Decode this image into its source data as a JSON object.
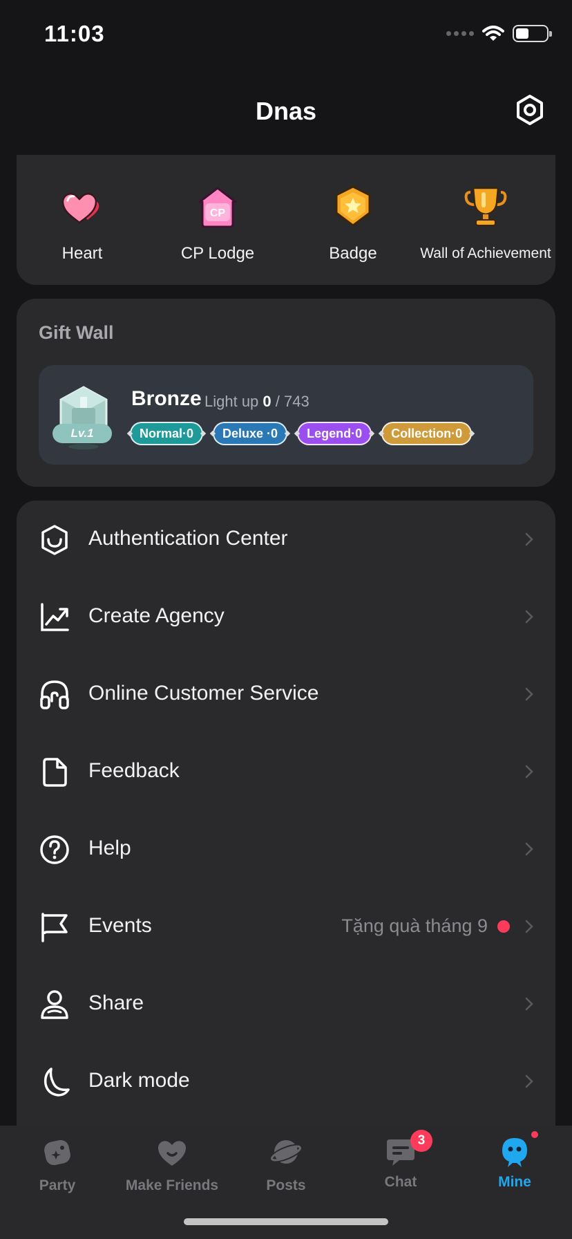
{
  "status": {
    "time": "11:03"
  },
  "header": {
    "title": "Dnas"
  },
  "features": [
    {
      "label": "Heart",
      "icon": "heart-icon"
    },
    {
      "label": "CP Lodge",
      "icon": "cp-lodge-icon",
      "icon_text": "CP"
    },
    {
      "label": "Badge",
      "icon": "badge-icon"
    },
    {
      "label": "Wall of Achievement",
      "icon": "trophy-icon"
    }
  ],
  "gift_wall": {
    "title": "Gift Wall",
    "level": "Lv.1",
    "rank": "Bronze",
    "light_label": "Light up",
    "lit": "0",
    "total": "/ 743",
    "pills": [
      {
        "label": "Normal·0",
        "color": "#1f9a9a"
      },
      {
        "label": "Deluxe ·0",
        "color": "#2a79b6"
      },
      {
        "label": "Legend·0",
        "color": "#9b4ff0"
      },
      {
        "label": "Collection·0",
        "color": "#cf9a3a"
      }
    ]
  },
  "menu": [
    {
      "label": "Authentication Center",
      "icon": "shield-check-icon"
    },
    {
      "label": "Create Agency",
      "icon": "chart-up-icon"
    },
    {
      "label": "Online Customer Service",
      "icon": "headset-icon"
    },
    {
      "label": "Feedback",
      "icon": "document-icon"
    },
    {
      "label": "Help",
      "icon": "question-icon"
    },
    {
      "label": "Events",
      "icon": "flag-icon",
      "extra": "Tặng quà tháng 9"
    },
    {
      "label": "Share",
      "icon": "share-user-icon"
    },
    {
      "label": "Dark mode",
      "icon": "moon-icon"
    }
  ],
  "tabs": [
    {
      "label": "Party",
      "icon": "party-icon"
    },
    {
      "label": "Make Friends",
      "icon": "heart-friends-icon"
    },
    {
      "label": "Posts",
      "icon": "planet-icon"
    },
    {
      "label": "Chat",
      "icon": "chat-icon",
      "badge": "3"
    },
    {
      "label": "Mine",
      "icon": "mine-avatar-icon",
      "active": true
    }
  ],
  "colors": {
    "accent": "#1fa8f0",
    "alert": "#ff3b5c",
    "card": "#2a2a2d",
    "background": "#151517"
  }
}
